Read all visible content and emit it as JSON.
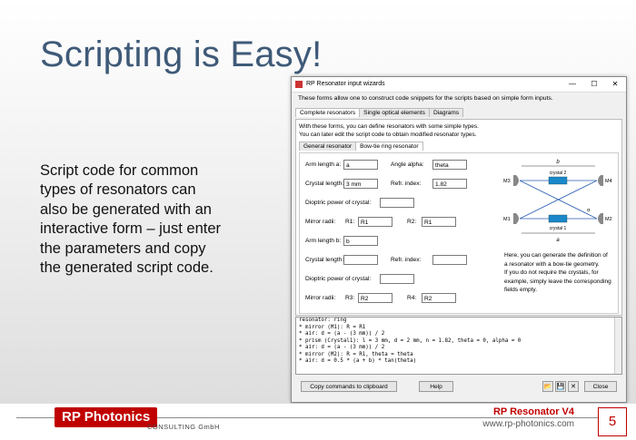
{
  "slide": {
    "title": "Scripting is Easy!",
    "body_lines": [
      "Script code for common",
      "types of resonators can",
      "also be generated with an",
      "interactive form – just enter",
      "the parameters and copy",
      "the generated script code."
    ]
  },
  "footer": {
    "logo": "RP Photonics",
    "consulting": "CONSULTING GmbH",
    "product": "RP Resonator V4",
    "website": "www.rp-photonics.com",
    "page": "5"
  },
  "window": {
    "title": "RP Resonator input wizards",
    "controls": {
      "minimize": "—",
      "maximize": "☐",
      "close": "✕"
    },
    "intro": "These forms allow one to construct code snippets for the scripts based on simple form inputs.",
    "tabs": [
      "Complete resonators",
      "Single optical elements",
      "Diagrams"
    ],
    "description": [
      "With these forms, you can define resonators with some simple types.",
      "You can later edit the script code to obtain modified resonator types."
    ],
    "subtabs": [
      "General resonator",
      "Bow-tie ring resonator"
    ],
    "form": {
      "arm_a_label": "Arm length a:",
      "arm_a_value": "a",
      "alpha_label": "Angle alpha:",
      "alpha_value": "theta",
      "crystal1_label": "Crystal length:",
      "crystal1_value": "3 mm",
      "refr1_label": "Refr. index:",
      "refr1_value": "1.82",
      "dioptric1_label": "Dioptric power of crystal:",
      "dioptric1_value": "",
      "mirror1_label": "Mirror radii:",
      "r1_label": "R1:",
      "r1_value": "R1",
      "r2_label": "R2:",
      "r2_value": "R1",
      "arm_b_label": "Arm length b:",
      "arm_b_value": "b",
      "crystal2_label": "Crystal length:",
      "crystal2_value": "",
      "refr2_label": "Refr. index:",
      "refr2_value": "",
      "dioptric2_label": "Dioptric power of crystal:",
      "dioptric2_value": "",
      "mirror2_label": "Mirror radii:",
      "r3_label": "R3:",
      "r3_value": "R2",
      "r4_label": "R4:",
      "r4_value": "R2"
    },
    "diagram": {
      "b": "b",
      "a": "a",
      "m1": "M1",
      "m2": "M2",
      "m3": "M3",
      "m4": "M4",
      "crystal1": "crystal 1",
      "crystal2": "crystal 2",
      "alpha": "α"
    },
    "help_lines": [
      "Here, you can generate the definition of",
      "a resonator with a bow-tie geometry.",
      "If you do not require the crystals, for",
      "example, simply leave the corresponding",
      "fields empty."
    ],
    "code_lines": [
      "resonator: ring",
      "* mirror (M1): R = R1",
      "* air: d = (a - (3 mm)) / 2",
      "* prism (Crystal1): l = 3 mm, d = 2 mm, n = 1.82, theta = 0, alpha = 0",
      "* air: d = (a - (3 mm)) / 2",
      "* mirror (M2): R = R1, theta = theta",
      "* air: d = 0.5 * (a + b) * tan(theta)"
    ],
    "buttons": {
      "copy": "Copy commands to clipboard",
      "help": "Help",
      "close": "Close"
    },
    "icons": {
      "open": "📂",
      "save": "💾",
      "clear": "✕"
    }
  }
}
